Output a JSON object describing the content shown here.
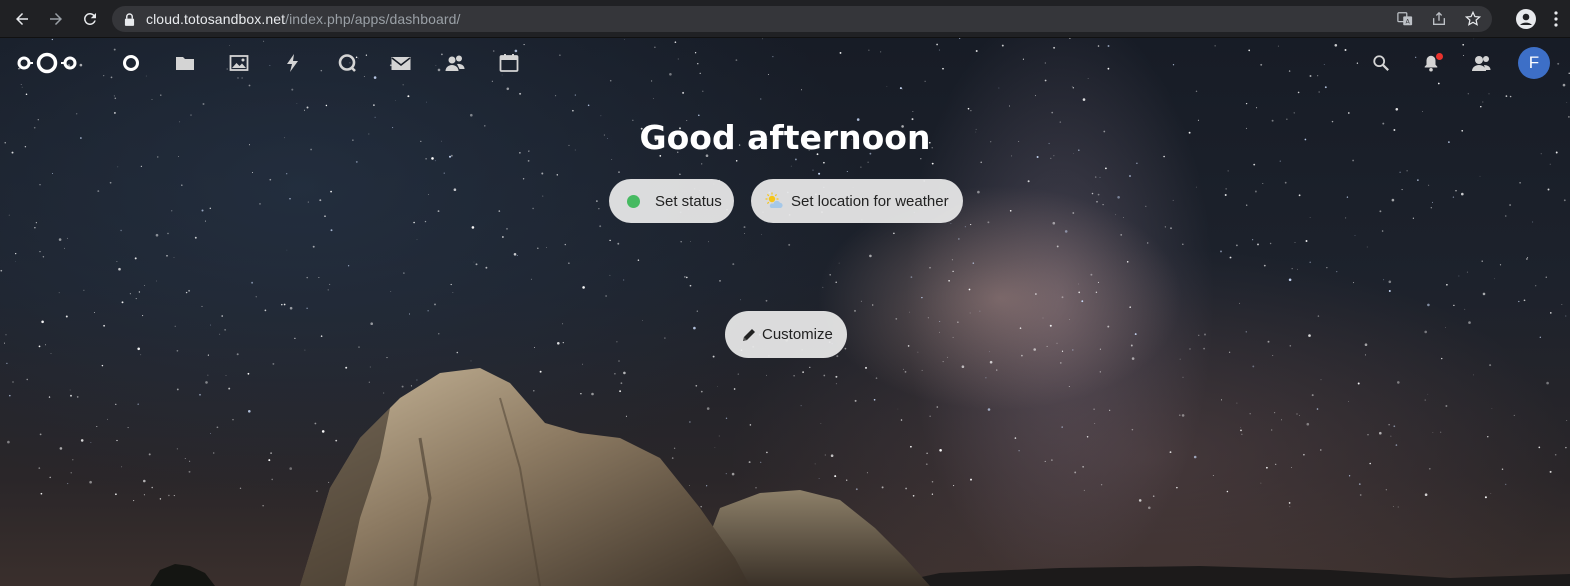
{
  "browser": {
    "url_domain": "cloud.totosandbox.net",
    "url_path": "/index.php/apps/dashboard/",
    "icons": [
      "back-icon",
      "forward-icon",
      "reload-icon",
      "lock-icon",
      "translate-icon",
      "share-icon",
      "bookmark-star-icon",
      "profile-icon",
      "menu-icon"
    ]
  },
  "header": {
    "logo": "nextcloud-logo",
    "apps": [
      {
        "name": "dashboard",
        "icon": "dashboard-icon"
      },
      {
        "name": "files",
        "icon": "folder-icon"
      },
      {
        "name": "photos",
        "icon": "image-icon"
      },
      {
        "name": "activity",
        "icon": "lightning-icon"
      },
      {
        "name": "talk",
        "icon": "talk-icon"
      },
      {
        "name": "mail",
        "icon": "mail-icon"
      },
      {
        "name": "contacts",
        "icon": "contacts-icon"
      },
      {
        "name": "calendar",
        "icon": "calendar-icon"
      }
    ],
    "right_icons": [
      "search-icon",
      "bell-icon",
      "contacts-menu-icon"
    ],
    "avatar_initial": "F",
    "avatar_color": "#3d6fc7"
  },
  "main": {
    "greeting": "Good afternoon",
    "set_status_label": "Set status",
    "status_color": "#46ba61",
    "weather_label": "Set location for weather",
    "customize_label": "Customize"
  }
}
